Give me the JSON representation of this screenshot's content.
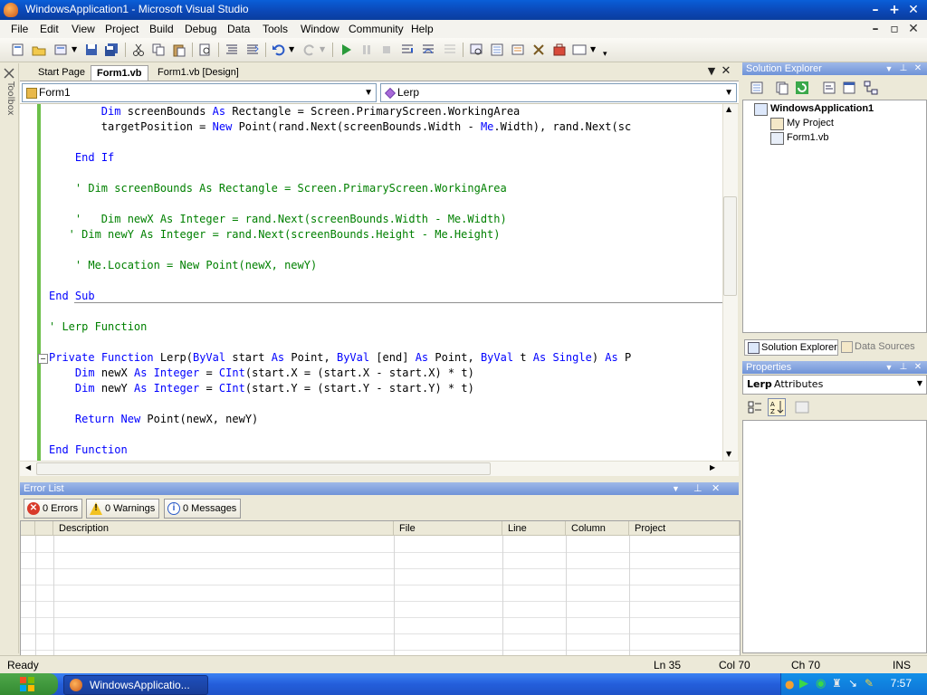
{
  "window": {
    "title": "WindowsApplication1 - Microsoft Visual Studio"
  },
  "menu": [
    "File",
    "Edit",
    "View",
    "Project",
    "Build",
    "Debug",
    "Data",
    "Tools",
    "Window",
    "Community",
    "Help"
  ],
  "toolbox_label": "Toolbox",
  "doc_tabs": [
    {
      "label": "Start Page",
      "active": false
    },
    {
      "label": "Form1.vb",
      "active": true
    },
    {
      "label": "Form1.vb [Design]",
      "active": false
    }
  ],
  "nav": {
    "class_combo": "Form1",
    "member_combo": "Lerp"
  },
  "code_lines": [
    {
      "text": "        Dim screenBounds As Rectangle = Screen.PrimaryScreen.WorkingArea",
      "kind": "code"
    },
    {
      "text": "        targetPosition = New Point(rand.Next(screenBounds.Width - Me.Width), rand.Next(sc",
      "kind": "code"
    },
    {
      "text": "",
      "kind": "code"
    },
    {
      "text": "    End If",
      "kind": "code"
    },
    {
      "text": "",
      "kind": "code"
    },
    {
      "text": "    ' Dim screenBounds As Rectangle = Screen.PrimaryScreen.WorkingArea",
      "kind": "comment"
    },
    {
      "text": "",
      "kind": "code"
    },
    {
      "text": "    '   Dim newX As Integer = rand.Next(screenBounds.Width - Me.Width)",
      "kind": "comment"
    },
    {
      "text": "   ' Dim newY As Integer = rand.Next(screenBounds.Height - Me.Height)",
      "kind": "comment"
    },
    {
      "text": "",
      "kind": "code"
    },
    {
      "text": "    ' Me.Location = New Point(newX, newY)",
      "kind": "comment"
    },
    {
      "text": "",
      "kind": "code"
    },
    {
      "text": "End Sub",
      "kind": "code"
    },
    {
      "text": "",
      "kind": "code"
    },
    {
      "text": "' Lerp Function",
      "kind": "comment"
    },
    {
      "text": "",
      "kind": "code"
    },
    {
      "text": "Private Function Lerp(ByVal start As Point, ByVal [end] As Point, ByVal t As Single) As P",
      "kind": "code"
    },
    {
      "text": "    Dim newX As Integer = CInt(start.X = (start.X - start.X) * t)",
      "kind": "code"
    },
    {
      "text": "    Dim newY As Integer = CInt(start.Y = (start.Y - start.Y) * t)",
      "kind": "code"
    },
    {
      "text": "",
      "kind": "code"
    },
    {
      "text": "    Return New Point(newX, newY)",
      "kind": "code"
    },
    {
      "text": "",
      "kind": "code"
    },
    {
      "text": "End Function",
      "kind": "code"
    }
  ],
  "keywords": [
    "Dim",
    "As",
    "New",
    "End",
    "If",
    "Sub",
    "Private",
    "Function",
    "ByVal",
    "Integer",
    "Single",
    "Return",
    "CInt",
    "Me"
  ],
  "error_list": {
    "title": "Error List",
    "errors_label": "0 Errors",
    "warnings_label": "0 Warnings",
    "messages_label": "0 Messages",
    "columns": [
      "",
      "",
      "Description",
      "File",
      "Line",
      "Column",
      "Project"
    ]
  },
  "solution_explorer": {
    "title": "Solution Explorer",
    "items": [
      {
        "label": "WindowsApplication1",
        "bold": true
      },
      {
        "label": "My Project",
        "bold": false
      },
      {
        "label": "Form1.vb",
        "bold": false
      }
    ]
  },
  "panel_tabs": [
    {
      "label": "Solution Explorer",
      "active": true
    },
    {
      "label": "Data Sources",
      "active": false
    }
  ],
  "properties": {
    "title": "Properties",
    "object_name": "Lerp",
    "object_type": "Attributes"
  },
  "status": {
    "ready": "Ready",
    "ln": "Ln 35",
    "col": "Col 70",
    "ch": "Ch 70",
    "ins": "INS"
  },
  "taskbar": {
    "item": "WindowsApplicatio...",
    "clock": "7:57"
  },
  "colors": {
    "keyword": "#0000ff",
    "comment": "#008000",
    "titlebar": "#0b46b4"
  }
}
